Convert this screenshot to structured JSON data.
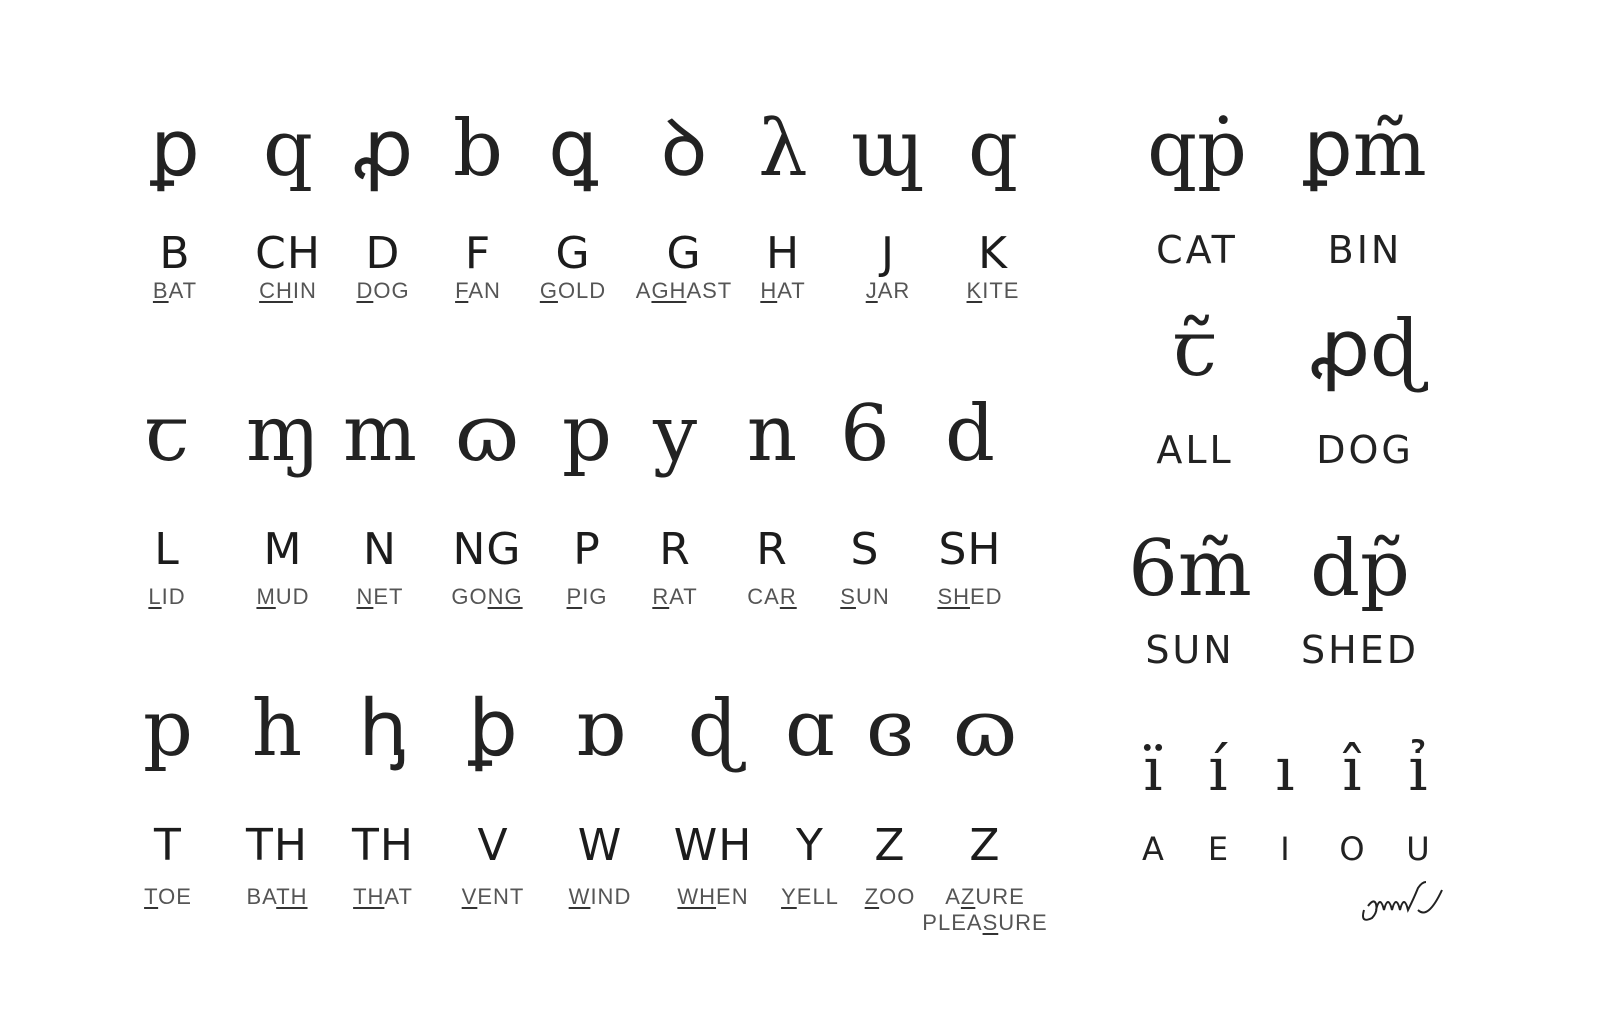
{
  "consonants": [
    {
      "letter": "B",
      "word": [
        "",
        "B",
        "AT"
      ]
    },
    {
      "letter": "CH",
      "word": [
        "",
        "CH",
        "IN"
      ]
    },
    {
      "letter": "D",
      "word": [
        "",
        "D",
        "OG"
      ]
    },
    {
      "letter": "F",
      "word": [
        "",
        "F",
        "AN"
      ]
    },
    {
      "letter": "G",
      "word": [
        "",
        "G",
        "OLD"
      ]
    },
    {
      "letter": "G",
      "word": [
        "A",
        "GH",
        "AST"
      ]
    },
    {
      "letter": "H",
      "word": [
        "",
        "H",
        "AT"
      ]
    },
    {
      "letter": "J",
      "word": [
        "",
        "J",
        "AR"
      ]
    },
    {
      "letter": "K",
      "word": [
        "",
        "K",
        "ITE"
      ]
    },
    {
      "letter": "L",
      "word": [
        "",
        "L",
        "ID"
      ]
    },
    {
      "letter": "M",
      "word": [
        "",
        "M",
        "UD"
      ]
    },
    {
      "letter": "N",
      "word": [
        "",
        "N",
        "ET"
      ]
    },
    {
      "letter": "NG",
      "word": [
        "GO",
        "NG",
        ""
      ]
    },
    {
      "letter": "P",
      "word": [
        "",
        "P",
        "IG"
      ]
    },
    {
      "letter": "R",
      "word": [
        "",
        "R",
        "AT"
      ]
    },
    {
      "letter": "R",
      "word": [
        "CA",
        "R",
        ""
      ]
    },
    {
      "letter": "S",
      "word": [
        "",
        "S",
        "UN"
      ]
    },
    {
      "letter": "SH",
      "word": [
        "",
        "SH",
        "ED"
      ]
    },
    {
      "letter": "T",
      "word": [
        "",
        "T",
        "OE"
      ]
    },
    {
      "letter": "TH",
      "word": [
        "BA",
        "TH",
        ""
      ]
    },
    {
      "letter": "TH",
      "word": [
        "",
        "TH",
        "AT"
      ]
    },
    {
      "letter": "V",
      "word": [
        "",
        "V",
        "ENT"
      ]
    },
    {
      "letter": "W",
      "word": [
        "",
        "W",
        "IND"
      ]
    },
    {
      "letter": "WH",
      "word": [
        "",
        "WH",
        "EN"
      ]
    },
    {
      "letter": "Y",
      "word": [
        "",
        "Y",
        "ELL"
      ]
    },
    {
      "letter": "Z",
      "word": [
        "",
        "Z",
        "OO"
      ]
    },
    {
      "letter": "Z",
      "word": [
        "A",
        "Z",
        "URE"
      ],
      "word2": [
        "PLEA",
        "S",
        "URE"
      ]
    }
  ],
  "examples": [
    "CAT",
    "BIN",
    "ALL",
    "DOG",
    "SUN",
    "SHED"
  ],
  "vowels": [
    "A",
    "E",
    "I",
    "O",
    "U"
  ],
  "signature": "omm"
}
